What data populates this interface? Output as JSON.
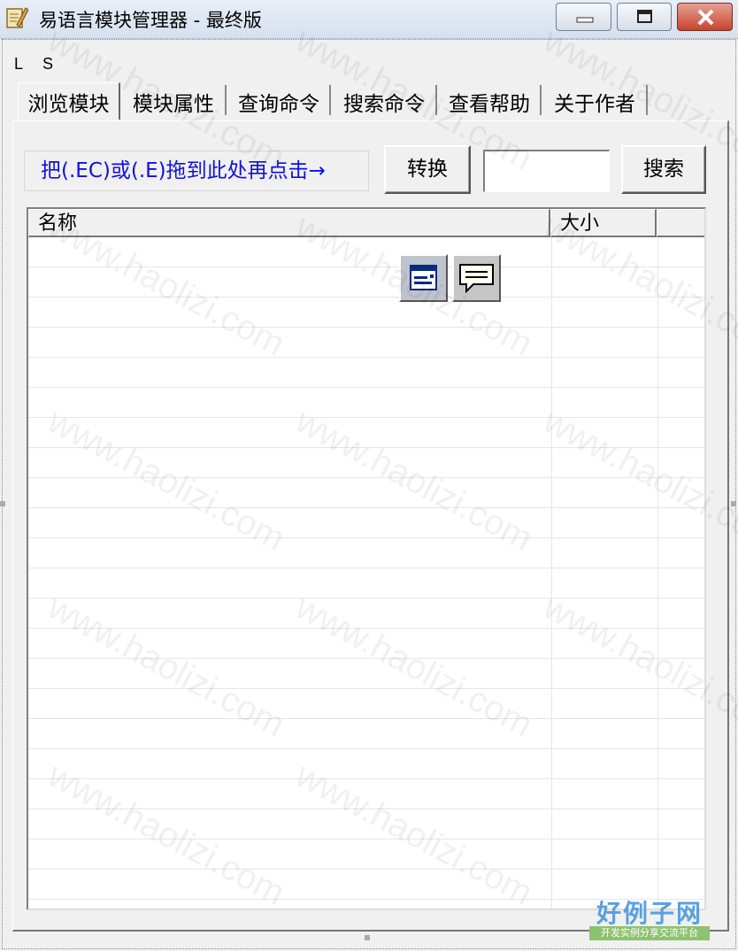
{
  "window": {
    "title": "易语言模块管理器 - 最终版",
    "icon": "notepad-pen-icon"
  },
  "window_buttons": {
    "minimize": "minimize-icon",
    "maximize": "maximize-icon",
    "close": "close-icon"
  },
  "menu": {
    "items": [
      "L",
      "S"
    ]
  },
  "tabs": [
    {
      "label": "浏览模块",
      "active": true
    },
    {
      "label": "模块属性",
      "active": false
    },
    {
      "label": "查询命令",
      "active": false
    },
    {
      "label": "搜索命令",
      "active": false
    },
    {
      "label": "查看帮助",
      "active": false
    },
    {
      "label": "关于作者",
      "active": false
    }
  ],
  "browse": {
    "drop_hint": "把(.EC)或(.E)拖到此处再点击→",
    "convert_label": "转换",
    "search_value": "",
    "search_label": "搜索"
  },
  "listview": {
    "columns": [
      "名称",
      "大小",
      ""
    ],
    "rows": []
  },
  "palette": {
    "icons": [
      "window-form-icon",
      "speech-bubble-icon"
    ]
  },
  "watermark": {
    "text": "www.haolizi.com",
    "brand": "好例子网",
    "brand_sub": "开发实例分享交流平台"
  },
  "colors": {
    "hint_text": "#1010e0",
    "close_button": "#c7432f",
    "brand_blue": "#5aa0e0",
    "brand_green": "#8dc26f"
  }
}
